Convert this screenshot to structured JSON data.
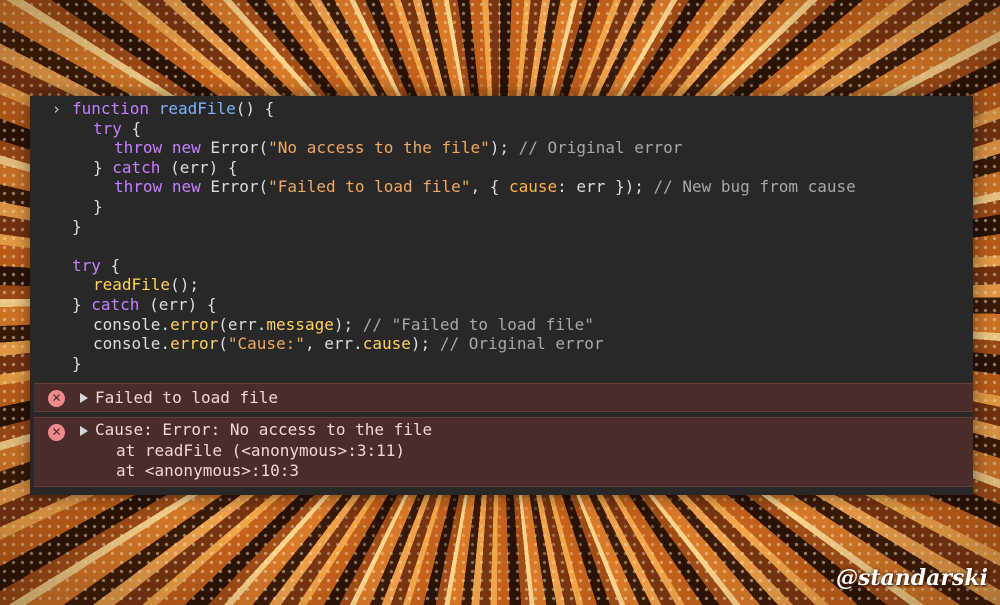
{
  "console": {
    "prompt_glyph": "›",
    "code_lines": [
      [
        {
          "t": "function",
          "c": "kw"
        },
        {
          "t": " "
        },
        {
          "t": "readFile",
          "c": "fn"
        },
        {
          "t": "() {"
        }
      ],
      [
        {
          "t": "try",
          "c": "kw"
        },
        {
          "t": " {"
        }
      ],
      [
        {
          "t": "throw",
          "c": "kw"
        },
        {
          "t": " "
        },
        {
          "t": "new",
          "c": "kw"
        },
        {
          "t": " Error("
        },
        {
          "t": "\"No access to the file\"",
          "c": "str"
        },
        {
          "t": "); "
        },
        {
          "t": "// Original error",
          "c": "cmt"
        }
      ],
      [
        {
          "t": "} "
        },
        {
          "t": "catch",
          "c": "kw"
        },
        {
          "t": " (err) {"
        }
      ],
      [
        {
          "t": "throw",
          "c": "kw"
        },
        {
          "t": " "
        },
        {
          "t": "new",
          "c": "kw"
        },
        {
          "t": " Error("
        },
        {
          "t": "\"Failed to load file\"",
          "c": "str"
        },
        {
          "t": ", { "
        },
        {
          "t": "cause",
          "c": "ent"
        },
        {
          "t": ": err }); "
        },
        {
          "t": "// New bug from cause",
          "c": "cmt"
        }
      ],
      [
        {
          "t": "}"
        }
      ],
      [
        {
          "t": "}"
        }
      ],
      [
        {
          "t": ""
        }
      ],
      [
        {
          "t": "try",
          "c": "kw"
        },
        {
          "t": " {"
        }
      ],
      [
        {
          "t": "readFile",
          "c": "prop"
        },
        {
          "t": "();"
        }
      ],
      [
        {
          "t": "} "
        },
        {
          "t": "catch",
          "c": "kw"
        },
        {
          "t": " (err) {"
        }
      ],
      [
        {
          "t": "console."
        },
        {
          "t": "error",
          "c": "prop"
        },
        {
          "t": "(err."
        },
        {
          "t": "message",
          "c": "prop"
        },
        {
          "t": "); "
        },
        {
          "t": "// \"Failed to load file\"",
          "c": "cmt"
        }
      ],
      [
        {
          "t": "console."
        },
        {
          "t": "error",
          "c": "prop"
        },
        {
          "t": "("
        },
        {
          "t": "\"Cause:\"",
          "c": "str"
        },
        {
          "t": ", err."
        },
        {
          "t": "cause",
          "c": "prop"
        },
        {
          "t": "); "
        },
        {
          "t": "// Original error",
          "c": "cmt"
        }
      ],
      [
        {
          "t": "}"
        }
      ]
    ],
    "error_1": {
      "icon": "error-icon",
      "message": "Failed to load file"
    },
    "error_2": {
      "icon": "error-icon",
      "message": "Cause: Error: No access to the file",
      "stack": [
        "at readFile (<anonymous>:3:11)",
        "at <anonymous>:10:3"
      ]
    }
  },
  "watermark": "@standarski",
  "colors": {
    "keyword": "#c580ff",
    "function": "#7eb4ff",
    "string": "#f2a860",
    "comment": "#a8a8a8",
    "property": "#ffd25e",
    "error_bg": "#4a2c29",
    "console_bg": "#282828"
  }
}
